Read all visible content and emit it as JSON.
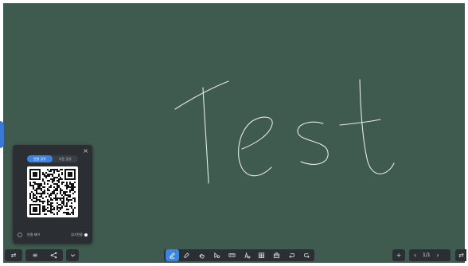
{
  "canvas": {
    "background": "#3f5a4e",
    "ink_color": "#e4ebe4",
    "handwritten_text": "Test"
  },
  "share_panel": {
    "close_glyph": "×",
    "tabs": [
      {
        "label": "연결 공유",
        "active": true
      },
      {
        "label": "다운 공유",
        "active": false
      }
    ],
    "footer": {
      "left_label": "연결 제어",
      "right_label": "읽기전용"
    }
  },
  "toolbar_left": {
    "buttons": [
      {
        "name": "swap-icon",
        "glyph": "⇄"
      },
      {
        "name": "menu-icon",
        "glyph": "≡"
      },
      {
        "name": "share-icon",
        "glyph": "<"
      },
      {
        "name": "chevron-down-icon",
        "glyph": "⌄"
      }
    ]
  },
  "toolbar_center": {
    "tools": [
      {
        "name": "pen-tool-icon",
        "active": true
      },
      {
        "name": "eraser-icon",
        "active": false
      },
      {
        "name": "select-hand-icon",
        "active": false
      },
      {
        "name": "shape-tool-icon",
        "active": false
      },
      {
        "name": "ruler-icon",
        "active": false
      },
      {
        "name": "text-tool-icon",
        "active": false
      },
      {
        "name": "table-icon",
        "active": false
      },
      {
        "name": "toolbox-icon",
        "active": false
      },
      {
        "name": "undo-icon",
        "active": false
      },
      {
        "name": "redo-icon",
        "active": false
      }
    ],
    "accent": "#3d84e0"
  },
  "toolbar_right": {
    "add_glyph": "+",
    "prev_glyph": "‹",
    "page_indicator": "1/1",
    "next_glyph": "›",
    "swap_glyph": "⇄"
  }
}
